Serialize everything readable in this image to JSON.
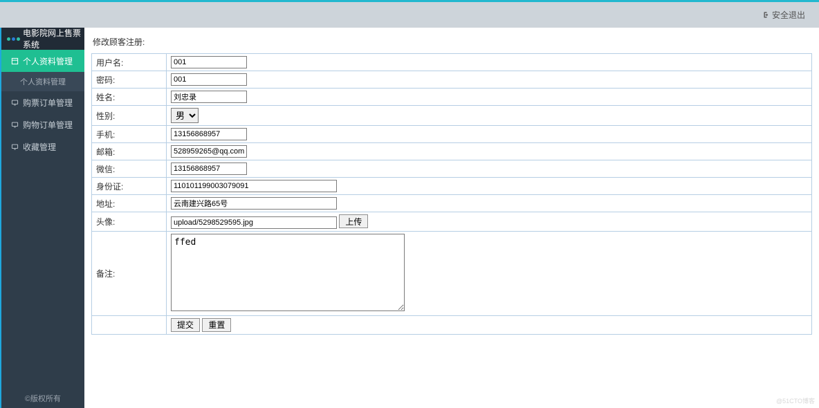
{
  "header": {
    "logout_label": "安全退出"
  },
  "sidebar": {
    "title": "电影院网上售票系统",
    "items": [
      {
        "label": "个人资料管理",
        "active": true
      },
      {
        "label": "购票订单管理",
        "active": false
      },
      {
        "label": "购物订单管理",
        "active": false
      },
      {
        "label": "收藏管理",
        "active": false
      }
    ],
    "sub_item": "个人资料管理",
    "footer": "©版权所有"
  },
  "page": {
    "title": "修改顾客注册:"
  },
  "form": {
    "username": {
      "label": "用户名:",
      "value": "001"
    },
    "password": {
      "label": "密码:",
      "value": "001"
    },
    "name": {
      "label": "姓名:",
      "value": "刘忠录"
    },
    "gender": {
      "label": "性别:",
      "value": "男"
    },
    "phone": {
      "label": "手机:",
      "value": "13156868957"
    },
    "email": {
      "label": "邮箱:",
      "value": "528959265@qq.com"
    },
    "wechat": {
      "label": "微信:",
      "value": "13156868957"
    },
    "idcard": {
      "label": "身份证:",
      "value": "110101199003079091"
    },
    "address": {
      "label": "地址:",
      "value": "云南建兴路65号"
    },
    "avatar": {
      "label": "头像:",
      "value": "upload/5298529595.jpg",
      "upload_btn": "上传"
    },
    "remark": {
      "label": "备注:",
      "value": "ffed"
    },
    "buttons": {
      "submit": "提交",
      "reset": "重置"
    }
  },
  "watermark": "@51CTO博客"
}
